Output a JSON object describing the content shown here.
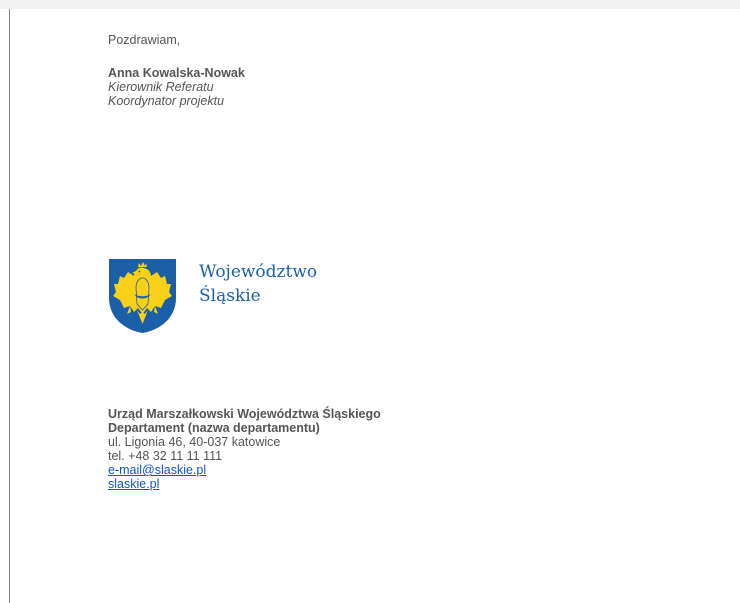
{
  "letter": {
    "greeting": "Pozdrawiam,",
    "signature": {
      "name": "Anna Kowalska-Nowak",
      "title": "Kierownik Referatu",
      "role": "Koordynator projektu"
    }
  },
  "logo": {
    "line1": "Województwo",
    "line2": "Śląskie",
    "icon": "eagle-shield-icon",
    "colors": {
      "shield_blue": "#1b5fa8",
      "eagle_yellow": "#f7d117",
      "text_blue": "#1b5fa8"
    }
  },
  "footer": {
    "organization": "Urząd Marszałkowski Województwa Śląskiego",
    "department": "Departament (nazwa departamentu)",
    "address": "ul. Ligonia 46, 40-037 katowice",
    "phone": "tel. +48 32 11 11 111",
    "email": "e-mail@slaskie.pl",
    "website": "slaskie.pl"
  },
  "colors": {
    "text": "#555555",
    "link": "#1155cc"
  }
}
